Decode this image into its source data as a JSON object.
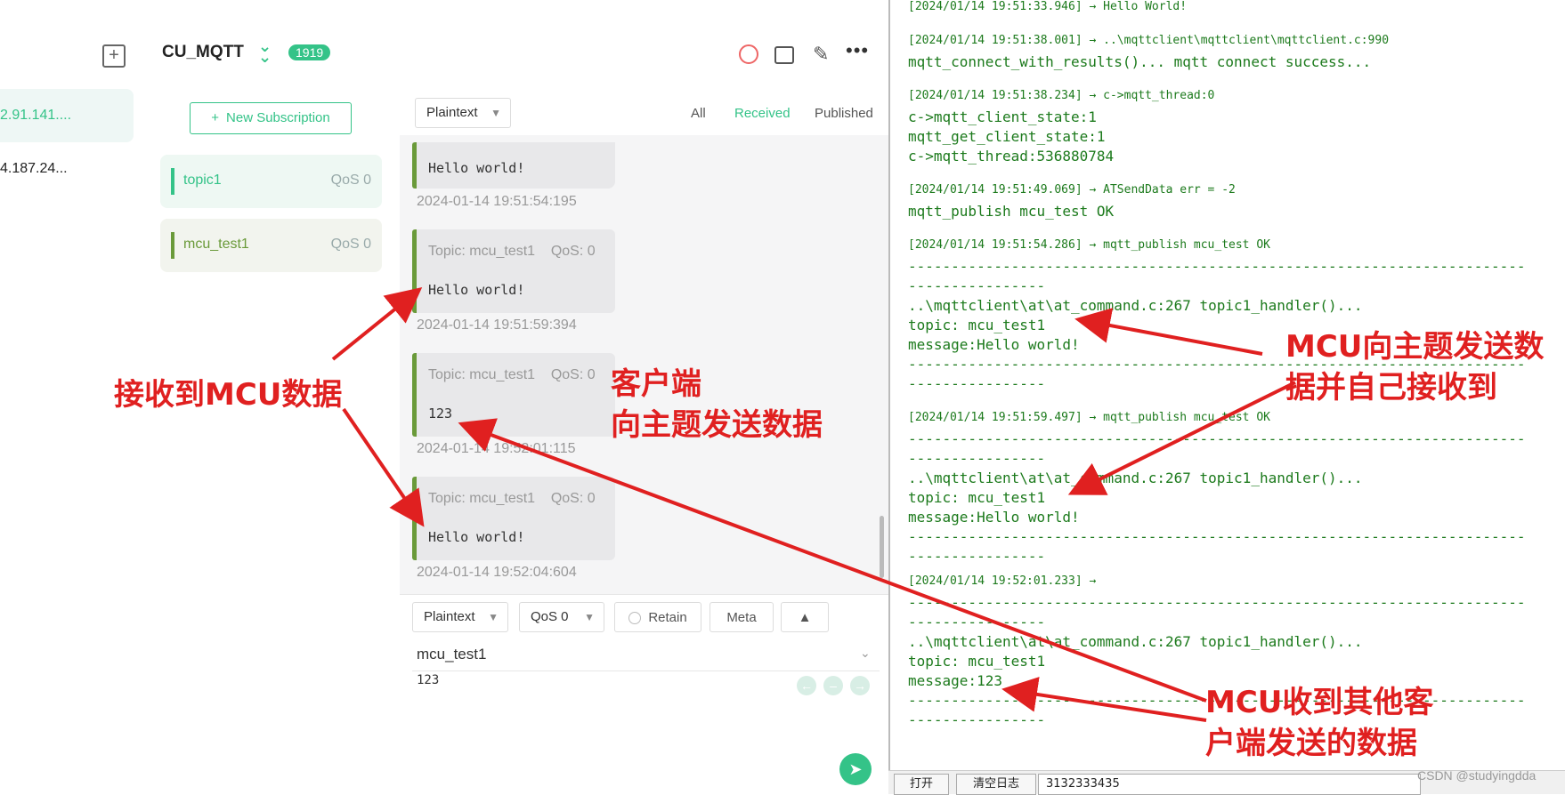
{
  "connections": [
    {
      "label": "2.91.141....",
      "active": true
    },
    {
      "label": "4.187.24...",
      "active": false
    }
  ],
  "header": {
    "title": "CU_MQTT",
    "count": "1919"
  },
  "subscriptions": {
    "new_label": "New Subscription",
    "items": [
      {
        "topic": "topic1",
        "qos": "QoS 0",
        "color": "#34c388"
      },
      {
        "topic": "mcu_test1",
        "qos": "QoS 0",
        "color": "#6a9a3a"
      }
    ]
  },
  "messages": {
    "format": "Plaintext",
    "filters": [
      "All",
      "Received",
      "Published"
    ],
    "list": [
      {
        "meta": "",
        "payload": "Hello world!",
        "time": "2024-01-14 19:51:54:195"
      },
      {
        "meta": "Topic: mcu_test1    QoS: 0",
        "payload": "Hello world!",
        "time": "2024-01-14 19:51:59:394"
      },
      {
        "meta": "Topic: mcu_test1    QoS: 0",
        "payload": "123",
        "time": "2024-01-14 19:52:01:115"
      },
      {
        "meta": "Topic: mcu_test1    QoS: 0",
        "payload": "Hello world!",
        "time": "2024-01-14 19:52:04:604"
      }
    ]
  },
  "composer": {
    "format": "Plaintext",
    "qos": "QoS 0",
    "retain": "Retain",
    "meta": "Meta",
    "topic": "mcu_test1",
    "payload": "123"
  },
  "console": {
    "lines": [
      {
        "text": "[2024/01/14 19:51:33.946] → Hello World!",
        "top": 0
      },
      {
        "text": "[2024/01/14 19:51:38.001] → ..\\mqttclient\\mqttclient\\mqttclient.c:990",
        "top": 0
      },
      {
        "text": "mqtt_connect_with_results()... mqtt connect success...",
        "top": 0
      },
      {
        "text": "[2024/01/14 19:51:38.234] → c->mqtt_thread:0",
        "top": 0
      },
      {
        "text": "c->mqtt_client_state:1",
        "top": 0
      },
      {
        "text": "mqtt_get_client_state:1",
        "top": 0
      },
      {
        "text": "c->mqtt_thread:536880784",
        "top": 0
      },
      {
        "text": "[2024/01/14 19:51:49.069] → ATSendData err = -2",
        "top": 0
      },
      {
        "text": "mqtt_publish mcu_test OK",
        "top": 0
      },
      {
        "text": "[2024/01/14 19:51:54.286] → mqtt_publish mcu_test OK",
        "top": 0
      },
      {
        "text": "------------------------------------------------------------------------",
        "top": 0
      },
      {
        "text": "----------------",
        "top": 0
      },
      {
        "text": "..\\mqttclient\\at\\at_command.c:267 topic1_handler()...",
        "top": 0
      },
      {
        "text": "topic: mcu_test1",
        "top": 0
      },
      {
        "text": "message:Hello world!",
        "top": 0
      },
      {
        "text": "------------------------------------------------------------------------",
        "top": 0
      },
      {
        "text": "----------------",
        "top": 0
      },
      {
        "text": "[2024/01/14 19:51:59.497] → mqtt_publish mcu_test OK",
        "top": 0
      },
      {
        "text": "------------------------------------------------------------------------",
        "top": 0
      },
      {
        "text": "----------------",
        "top": 0
      },
      {
        "text": "..\\mqttclient\\at\\at_command.c:267 topic1_handler()...",
        "top": 0
      },
      {
        "text": "topic: mcu_test1",
        "top": 0
      },
      {
        "text": "message:Hello world!",
        "top": 0
      },
      {
        "text": "------------------------------------------------------------------------",
        "top": 0
      },
      {
        "text": "----------------",
        "top": 0
      },
      {
        "text": "[2024/01/14 19:52:01.233] →",
        "top": 0
      },
      {
        "text": "------------------------------------------------------------------------",
        "top": 0
      },
      {
        "text": "----------------",
        "top": 0
      },
      {
        "text": "..\\mqttclient\\at\\at_command.c:267 topic1_handler()...",
        "top": 0
      },
      {
        "text": "topic: mcu_test1",
        "top": 0
      },
      {
        "text": "message:123",
        "top": 0
      },
      {
        "text": "------------------------------------------------------------------------",
        "top": 0
      },
      {
        "text": "----------------",
        "top": 0
      }
    ],
    "open_btn": "打开",
    "clear_btn": "清空日志",
    "hex_field": "3132333435"
  },
  "annotations": {
    "received_mcu": "接收到MCU数据",
    "client_send_1": "客户端",
    "client_send_2": "向主题发送数据",
    "mcu_self_1": "MCU向主题发送数",
    "mcu_self_2": "据并自己接收到",
    "mcu_other_1": "MCU收到其他客",
    "mcu_other_2": "户端发送的数据"
  },
  "watermark": "CSDN @studyingdda"
}
